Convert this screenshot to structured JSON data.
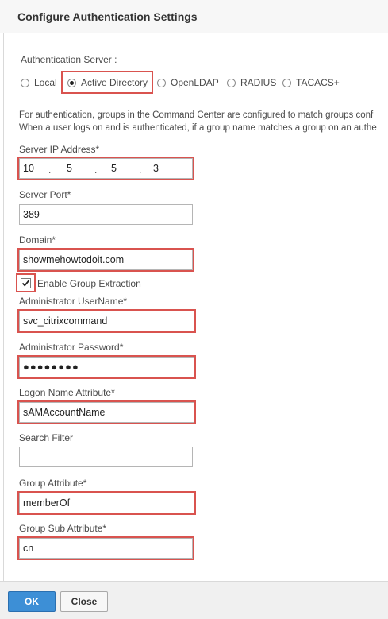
{
  "dialog": {
    "title": "Configure Authentication Settings"
  },
  "auth_server": {
    "label": "Authentication Server :",
    "options": [
      "Local",
      "Active Directory",
      "OpenLDAP",
      "RADIUS",
      "TACACS+"
    ],
    "selected": "Active Directory"
  },
  "info": {
    "line1": "For authentication, groups in the Command Center are configured to match groups conf",
    "line2": "When a user logs on and is authenticated, if a group name matches a group on an authe"
  },
  "server_ip": {
    "label": "Server IP Address*",
    "octets": [
      "10",
      "5",
      "5",
      "3"
    ]
  },
  "server_port": {
    "label": "Server Port*",
    "value": "389"
  },
  "domain": {
    "label": "Domain*",
    "value": "showmehowtodoit.com"
  },
  "group_extraction": {
    "label": "Enable Group Extraction",
    "checked": true
  },
  "admin_username": {
    "label": "Administrator UserName*",
    "value": "svc_citrixcommand"
  },
  "admin_password": {
    "label": "Administrator Password*",
    "value": "●●●●●●●●"
  },
  "logon_name_attr": {
    "label": "Logon Name Attribute*",
    "value": "sAMAccountName"
  },
  "search_filter": {
    "label": "Search Filter",
    "value": ""
  },
  "group_attr": {
    "label": "Group Attribute*",
    "value": "memberOf"
  },
  "group_sub_attr": {
    "label": "Group Sub Attribute*",
    "value": "cn"
  },
  "buttons": {
    "ok": "OK",
    "close": "Close"
  },
  "colors": {
    "highlight": "#d9534f",
    "primary": "#3d8fd6"
  }
}
